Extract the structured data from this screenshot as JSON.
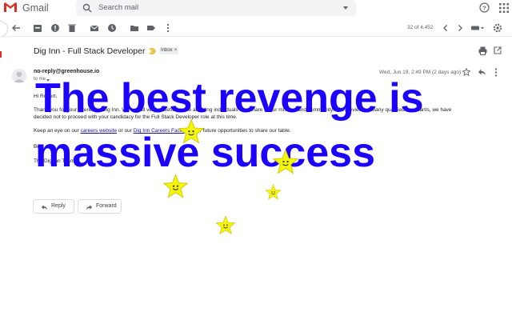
{
  "header": {
    "brand": "Gmail",
    "search_placeholder": "Search mail"
  },
  "toolbar": {
    "count": "32 of 4,452"
  },
  "email": {
    "subject": "Dig Inn - Full Stack Developer",
    "label": "Inbox",
    "label_close": "×",
    "sender": "no-reply@greenhouse.io",
    "to": "to me",
    "date": "Wed, Jun 19, 2:49 PM (2 days ago)",
    "greeting": "Hi Robert,",
    "para1_line1": "Thank you for your interest in Dig Inn. We are all very grateful for the amazing individuals that share in our mission and community. After reviewing many qualified applicants, we have",
    "para1_line2": "decided not to proceed with your candidacy for the Full Stack Developer role at this time.",
    "para2_pre": "Keep an eye on our",
    "link1": "careers website",
    "para2_mid": "or our",
    "link2": "Dig Inn Careers Facebook",
    "para2_post": "for future opportunities to share our table.",
    "closing": "Best,",
    "signature": "The Dig Inn Team"
  },
  "actions": {
    "reply": "Reply",
    "forward": "Forward"
  },
  "overlay": {
    "line1": "The best revenge is",
    "line2": "massive success",
    "text_color": "#1b00ff",
    "star_color": "#f5f50a"
  },
  "colors": {
    "gmail_red": "#d93025",
    "link": "#1a0dab"
  }
}
